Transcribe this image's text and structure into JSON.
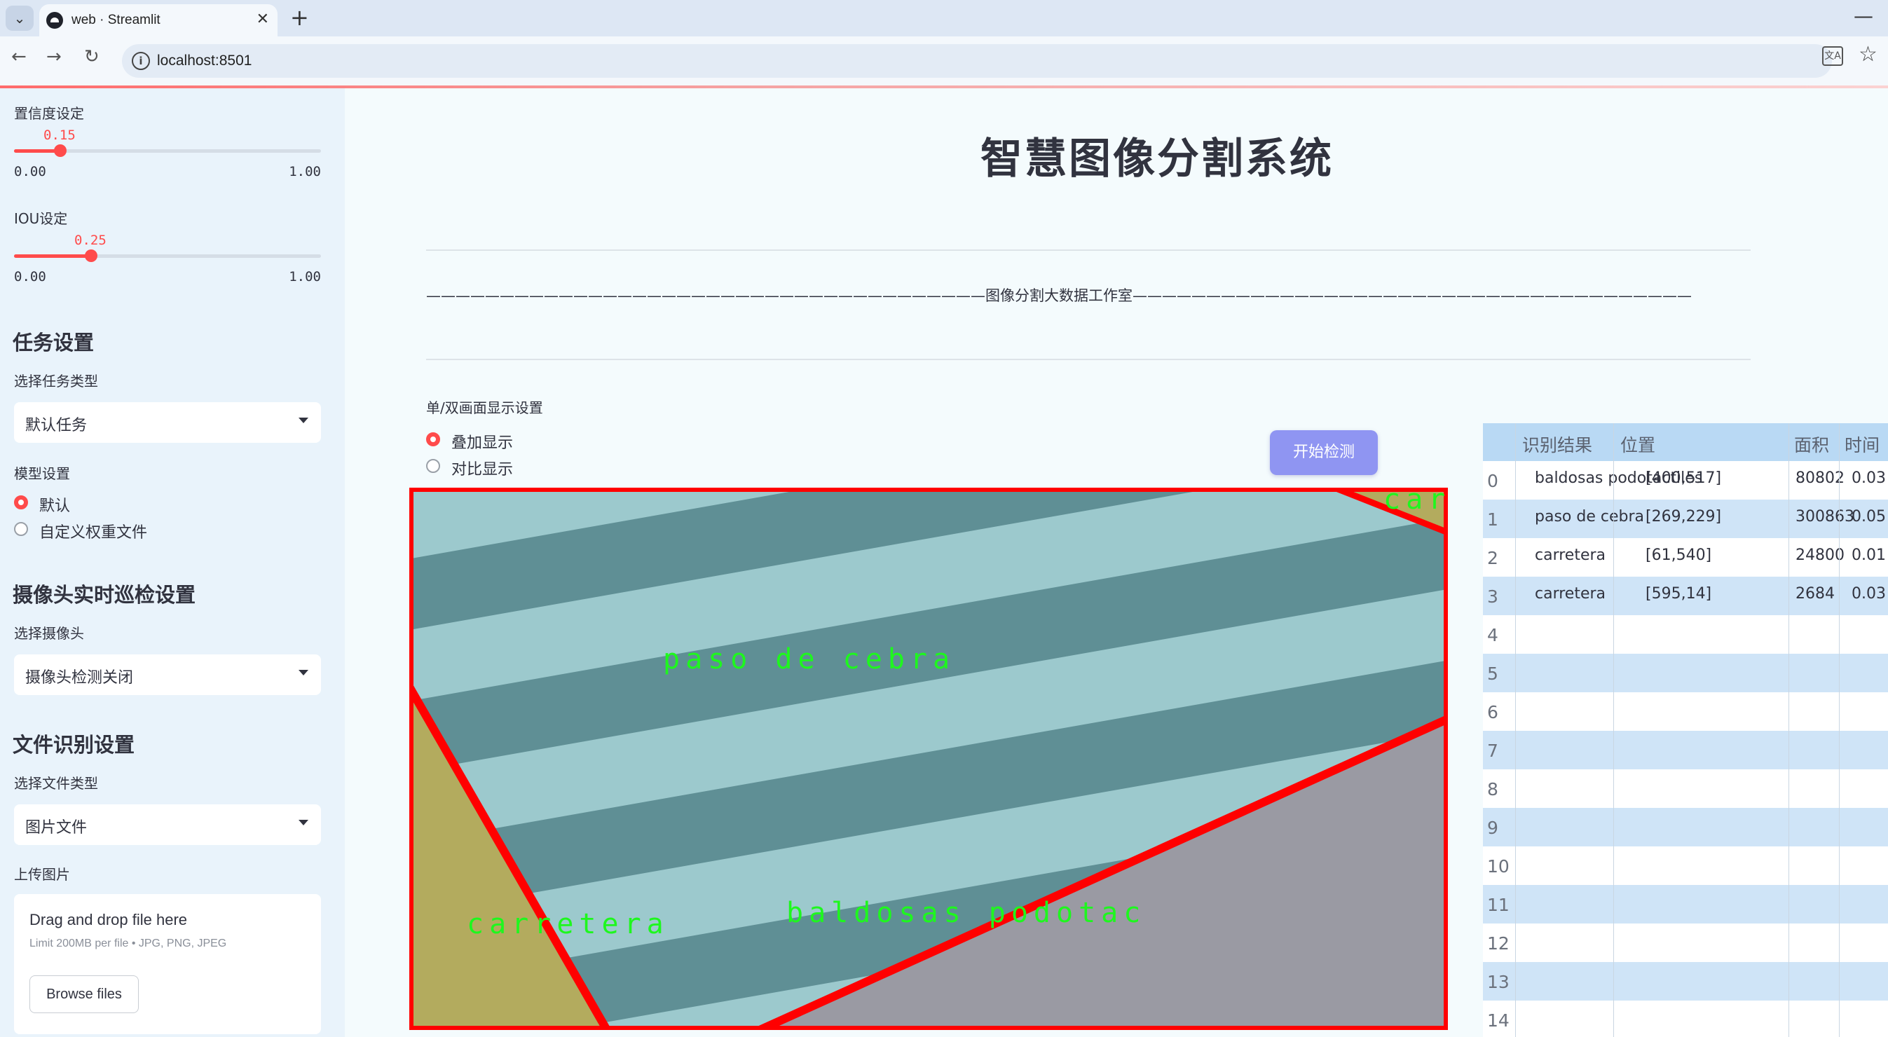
{
  "browser": {
    "tab_title": "web · Streamlit",
    "url": "localhost:8501"
  },
  "sidebar": {
    "conf_label": "置信度设定",
    "conf_value": "0.15",
    "conf_level": 0.15,
    "conf_min": "0.00",
    "conf_max": "1.00",
    "iou_label": "IOU设定",
    "iou_value": "0.25",
    "iou_level": 0.25,
    "iou_min": "0.00",
    "iou_max": "1.00",
    "task_header": "任务设置",
    "task_type_label": "选择任务类型",
    "task_type_value": "默认任务",
    "model_label": "模型设置",
    "model_options": [
      "默认",
      "自定义权重文件"
    ],
    "camera_header": "摄像头实时巡检设置",
    "camera_label": "选择摄像头",
    "camera_value": "摄像头检测关闭",
    "file_header": "文件识别设置",
    "file_type_label": "选择文件类型",
    "file_type_value": "图片文件",
    "upload_label": "上传图片",
    "dropzone_title": "Drag and drop file here",
    "dropzone_limit": "Limit 200MB per file • JPG, PNG, JPEG",
    "browse_button": "Browse files"
  },
  "main": {
    "title": "智慧图像分割系统",
    "studio_line": "——————————————————————————————————————图像分割大数据工作室——————————————————————————————————————",
    "display_label": "单/双画面显示设置",
    "display_options": [
      "叠加显示",
      "对比显示"
    ],
    "detect_button": "开始检测",
    "segment_labels": {
      "zebra": "paso de cebra",
      "road": "carretera",
      "tiles": "baldosas podotac",
      "corner": "car"
    }
  },
  "table": {
    "headers": [
      "识别结果",
      "位置",
      "面积",
      "时间"
    ],
    "rows": [
      {
        "index": "0",
        "result": "baldosas podotactiles",
        "position": "[400,517]",
        "area": "80802",
        "time": "0.03"
      },
      {
        "index": "1",
        "result": "paso de cebra",
        "position": "[269,229]",
        "area": "300863",
        "time": "0.05"
      },
      {
        "index": "2",
        "result": "carretera",
        "position": "[61,540]",
        "area": "24800",
        "time": "0.01"
      },
      {
        "index": "3",
        "result": "carretera",
        "position": "[595,14]",
        "area": "2684",
        "time": "0.03"
      }
    ],
    "empty_indices": [
      "4",
      "5",
      "6",
      "7",
      "8",
      "9",
      "10",
      "11",
      "12",
      "13",
      "14"
    ]
  },
  "colors": {
    "accent": "#ff4b4b",
    "button": "#8f95f2",
    "segment_outline": "#ff0000",
    "segment_text": "#1ef71e"
  }
}
